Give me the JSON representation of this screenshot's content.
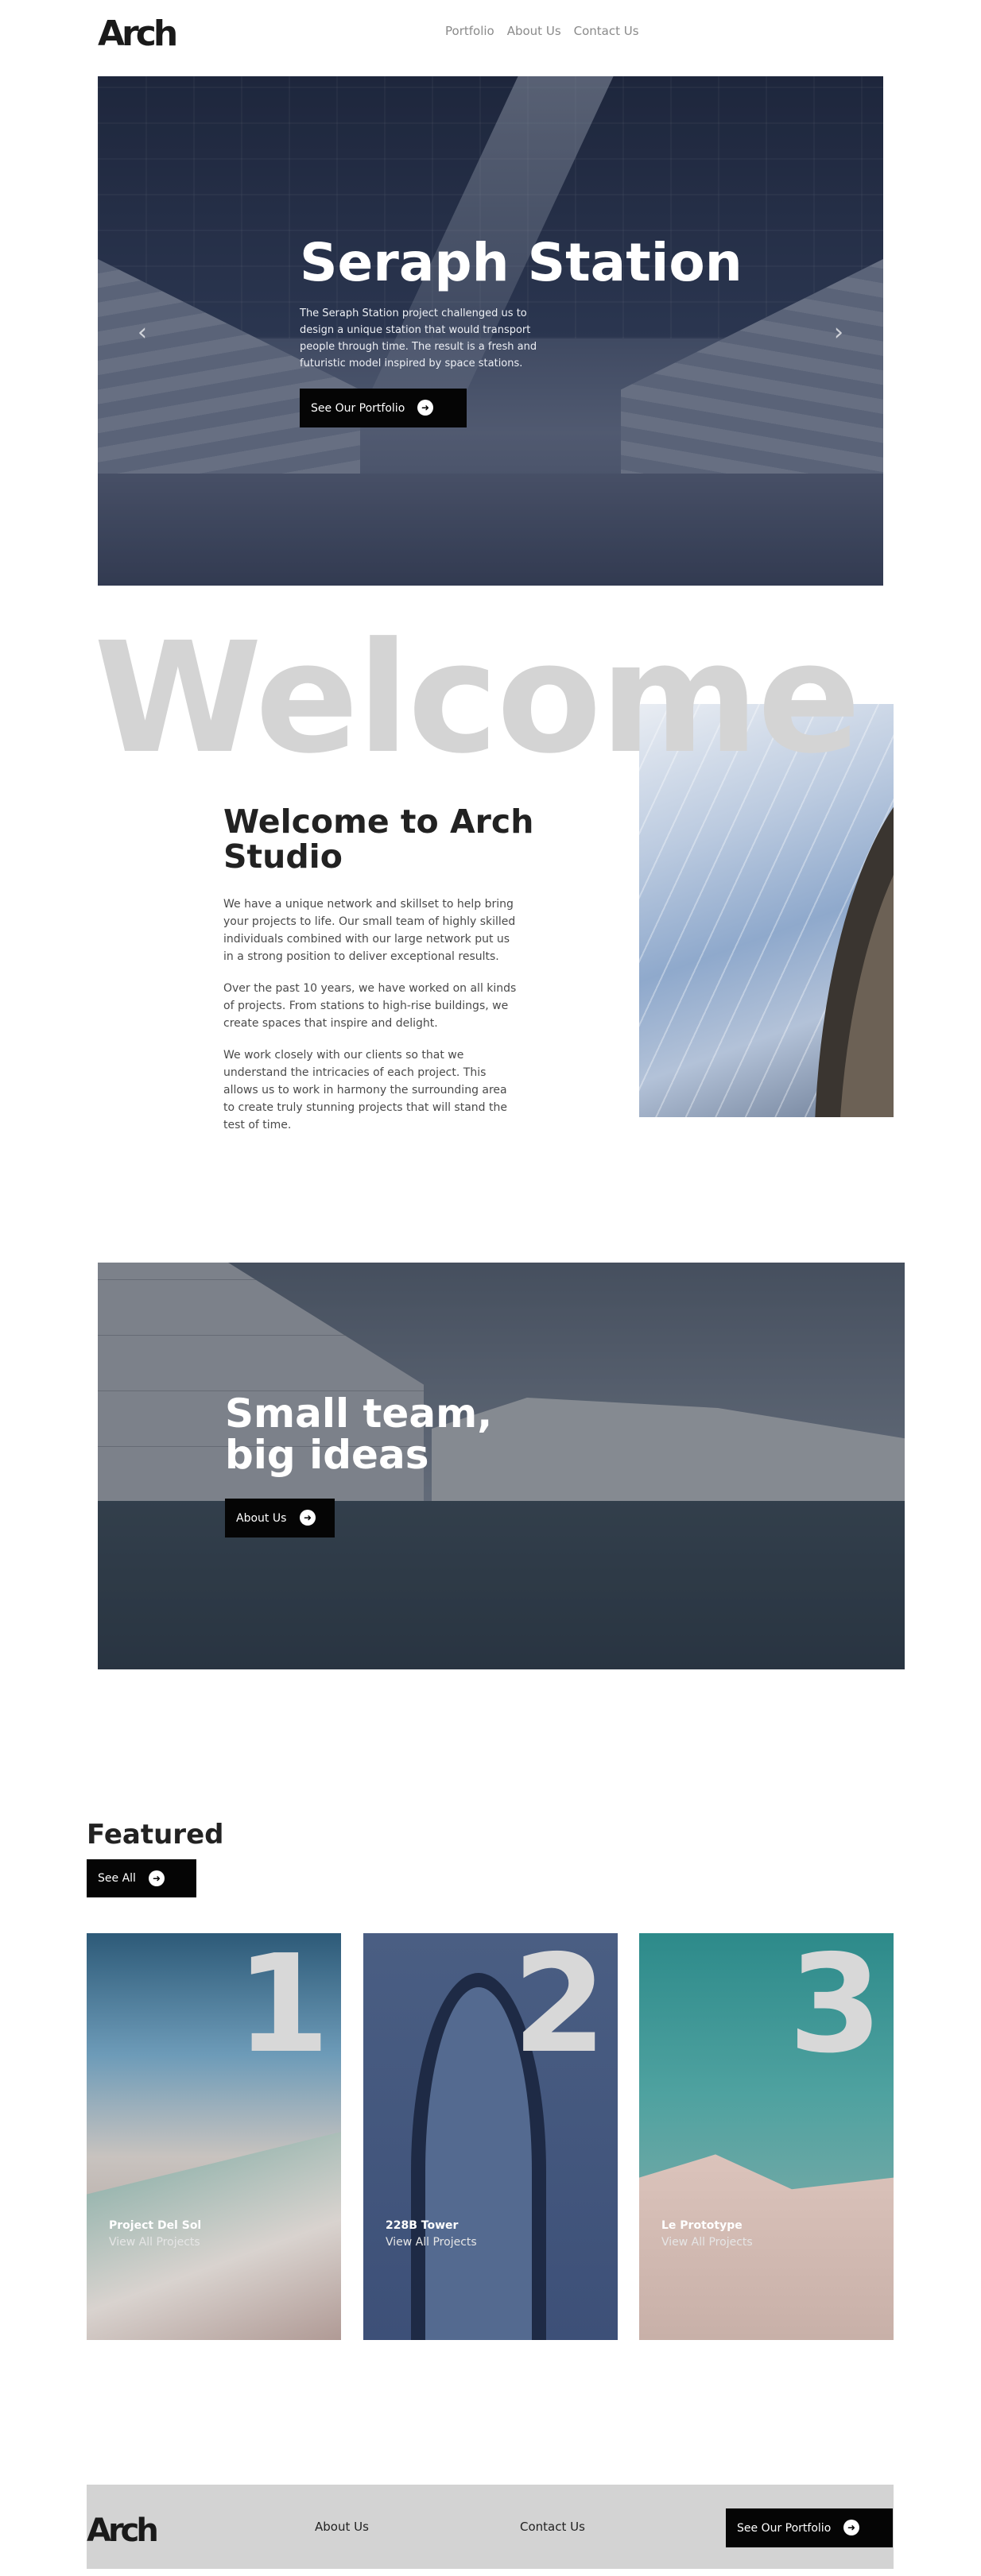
{
  "brand": {
    "logo_text": "Arch"
  },
  "nav": {
    "items": [
      "Portfolio",
      "About Us",
      "Contact Us"
    ]
  },
  "hero": {
    "title": "Seraph Station",
    "description": "The Seraph Station project challenged us to design a unique station that would transport people through time. The result is a fresh and futuristic model inspired by space stations.",
    "cta": "See Our Portfolio",
    "prev_icon": "chevron-left-icon",
    "next_icon": "chevron-right-icon"
  },
  "about": {
    "watermark": "Welcome",
    "title": "Welcome to Arch Studio",
    "paragraphs": [
      "We have a unique network and skillset to help bring your projects to life. Our small team of highly skilled individuals combined with our large network put us in a strong position to deliver exceptional results.",
      "Over the past 10 years, we have worked on all kinds of projects. From stations to high-rise buildings, we create spaces that inspire and delight.",
      "We work closely with our clients so that we understand the intricacies of each project. This allows us to work in harmony the surrounding area to create truly stunning projects that will stand the test of time."
    ]
  },
  "team": {
    "title_line1": "Small team,",
    "title_line2": "big ideas",
    "cta": "About Us"
  },
  "featured": {
    "title": "Featured",
    "cta": "See All",
    "cards": [
      {
        "number": "1",
        "name": "Project Del Sol",
        "link": "View All Projects"
      },
      {
        "number": "2",
        "name": "228B Tower",
        "link": "View All Projects"
      },
      {
        "number": "3",
        "name": "Le Prototype",
        "link": "View All Projects"
      }
    ]
  },
  "footer": {
    "links": [
      "About Us",
      "Contact Us"
    ],
    "cta": "See Our Portfolio"
  },
  "colors": {
    "accent": "#050505",
    "watermark": "#d4d4d4",
    "footer_bg": "#d3d3d3"
  }
}
